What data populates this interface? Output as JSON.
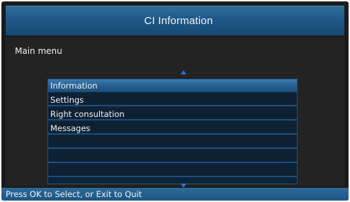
{
  "header": {
    "title": "CI Information"
  },
  "main": {
    "menu_title": "Main menu",
    "items": [
      {
        "label": "Information",
        "selected": true
      },
      {
        "label": "Settings",
        "selected": false
      },
      {
        "label": "Right consultation",
        "selected": false
      },
      {
        "label": "Messages",
        "selected": false
      },
      {
        "label": "",
        "selected": false
      },
      {
        "label": "",
        "selected": false
      },
      {
        "label": "",
        "selected": false
      }
    ]
  },
  "footer": {
    "status": "Press OK to Select, or Exit to Quit"
  },
  "colors": {
    "title_bar": "#1f5887",
    "selected_row": "#2f6b9f",
    "scroll_arrow": "#2a73d6",
    "background": "#1b1b1b"
  },
  "icons": {
    "scroll_up": "triangle-up",
    "scroll_down": "triangle-down"
  }
}
